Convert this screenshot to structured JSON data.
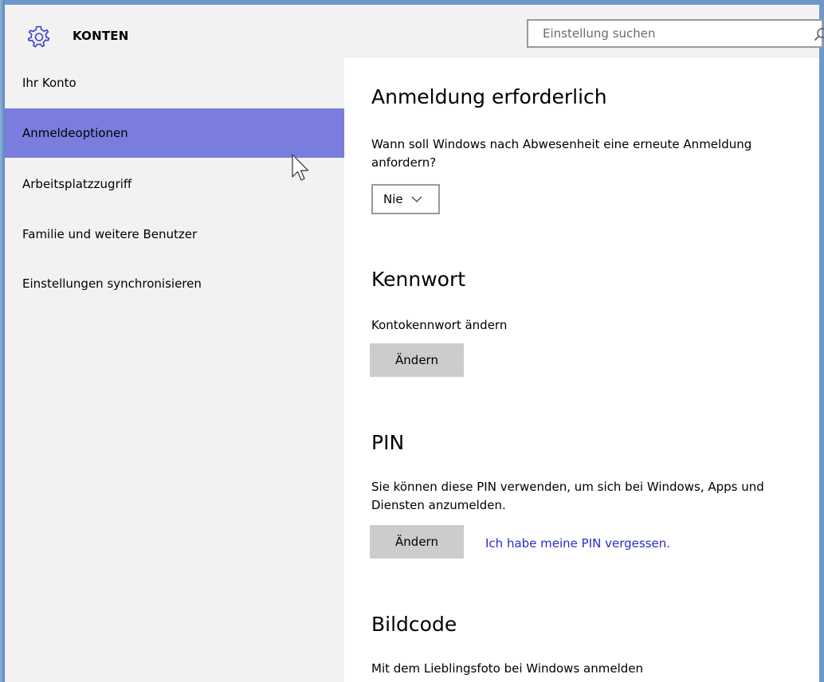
{
  "header": {
    "app_icon": "gear-icon",
    "title": "KONTEN",
    "search": {
      "placeholder": "Einstellung suchen",
      "value": "",
      "icon": "search-icon"
    }
  },
  "sidebar": {
    "items": [
      {
        "label": "Ihr Konto",
        "active": false
      },
      {
        "label": "Anmeldeoptionen",
        "active": true
      },
      {
        "label": "Arbeitsplatzzugriff",
        "active": false
      },
      {
        "label": "Familie und weitere Benutzer",
        "active": false
      },
      {
        "label": "Einstellungen synchronisieren",
        "active": false
      }
    ]
  },
  "main": {
    "sign_in_required": {
      "heading": "Anmeldung erforderlich",
      "description": "Wann soll Windows nach Abwesenheit eine erneute Anmeldung anfordern?",
      "dropdown_value": "Nie"
    },
    "password": {
      "heading": "Kennwort",
      "description": "Kontokennwort ändern",
      "button_label": "Ändern"
    },
    "pin": {
      "heading": "PIN",
      "description": "Sie können diese PIN verwenden, um sich bei Windows, Apps und Diensten anzumelden.",
      "button_label": "Ändern",
      "link_label": "Ich habe meine PIN vergessen."
    },
    "picture_password": {
      "heading": "Bildcode",
      "description": "Mit dem Lieblingsfoto bei Windows anmelden"
    }
  },
  "colors": {
    "sidebar_active": "#7a7ddd",
    "link": "#2a2ccc",
    "button_bg": "#cccccc",
    "panel_bg": "#f2f2f2"
  }
}
